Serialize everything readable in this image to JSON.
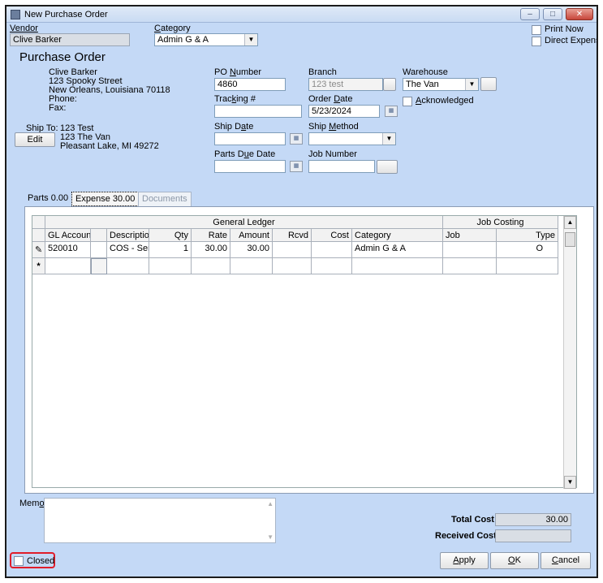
{
  "window": {
    "title": "New Purchase Order"
  },
  "header": {
    "vendor_label": "Vendor",
    "vendor_value": "Clive Barker",
    "category_label": "Category",
    "category_value": "Admin G & A",
    "print_now": "Print Now",
    "direct_expense": "Direct Expense"
  },
  "po": {
    "heading": "Purchase Order",
    "address_lines": [
      "Clive Barker",
      "123 Spooky Street",
      "New Orleans, Louisiana  70118",
      "Phone:",
      "Fax:"
    ],
    "ship_to_label": "Ship To:",
    "ship_to_lines": [
      "123 Test",
      "123 The Van",
      "Pleasant Lake, MI  49272"
    ],
    "edit_button": "Edit",
    "po_number_label": "PO Number",
    "po_number_value": "4860",
    "tracking_label": "Tracking #",
    "tracking_value": "",
    "ship_date_label": "Ship Date",
    "ship_date_value": "",
    "parts_due_label": "Parts Due Date",
    "parts_due_value": "",
    "branch_label": "Branch",
    "branch_value": "123 test",
    "order_date_label": "Order Date",
    "order_date_value": "5/23/2024",
    "ship_method_label": "Ship Method",
    "ship_method_value": "",
    "job_number_label": "Job Number",
    "job_number_value": "",
    "warehouse_label": "Warehouse",
    "warehouse_value": "The Van",
    "acknowledged_label": "Acknowledged"
  },
  "tabs": [
    {
      "label": "Parts  0.00"
    },
    {
      "label": "Expense  30.00"
    },
    {
      "label": "Documents"
    }
  ],
  "grid": {
    "group_headers": [
      "General Ledger",
      "Job Costing"
    ],
    "columns": [
      "GL Account",
      "",
      "Description",
      "Qty",
      "Rate",
      "Amount",
      "Rcvd",
      "Cost",
      "Category",
      "Job",
      "Type"
    ],
    "rows": [
      {
        "indicator": "✎",
        "cells": [
          "520010",
          "",
          "COS - Servi",
          "1",
          "30.00",
          "30.00",
          "",
          "",
          "Admin G & A",
          "",
          "O"
        ]
      }
    ],
    "new_row_indicator": "*"
  },
  "footer": {
    "memo_label": "Memo",
    "total_cost_label": "Total Cost",
    "total_cost_value": "30.00",
    "received_cost_label": "Received Cost",
    "received_cost_value": "",
    "closed_label": "Closed",
    "apply_button": "Apply",
    "ok_button": "OK",
    "cancel_button": "Cancel"
  },
  "colors": {
    "window_bg": "#c4d9f6",
    "closed_highlight": "#e01d2a"
  }
}
